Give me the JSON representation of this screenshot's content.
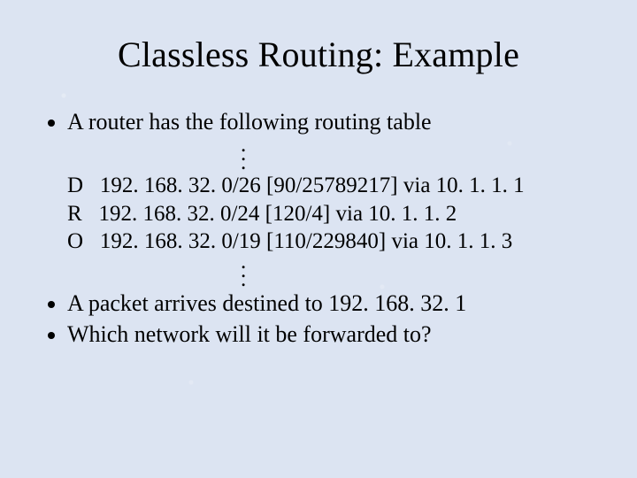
{
  "title": "Classless Routing: Example",
  "bullets": {
    "intro": "A router has the following routing table",
    "q1": "A packet arrives destined to 192. 168. 32. 1",
    "q2": "Which network will it be forwarded to?"
  },
  "routes": [
    {
      "code": "D",
      "net": "192. 168. 32. 0/26",
      "metric": "[90/25789217]",
      "via": "via 10. 1. 1. 1"
    },
    {
      "code": "R",
      "net": "192. 168. 32. 0/24",
      "metric": "[120/4]",
      "via": "via 10. 1. 1. 2"
    },
    {
      "code": "O",
      "net": "192. 168. 32. 0/19",
      "metric": "[110/229840]",
      "via": "via 10. 1. 1. 3"
    }
  ],
  "dot": "."
}
